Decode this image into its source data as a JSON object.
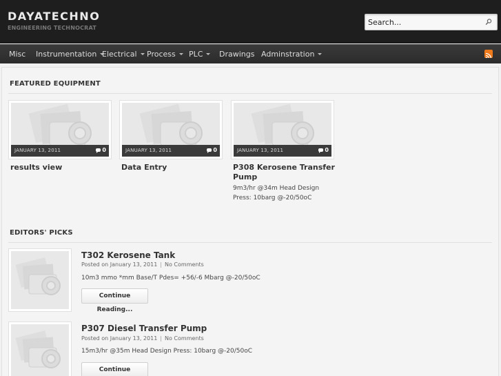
{
  "site": {
    "title": "DAYATECHNO",
    "tagline": "ENGINEERING TECHNOCRAT"
  },
  "search": {
    "placeholder": "Search..."
  },
  "nav": {
    "items": [
      {
        "label": "Misc",
        "dropdown": false
      },
      {
        "label": "Instrumentation",
        "dropdown": true
      },
      {
        "label": "Electrical",
        "dropdown": true
      },
      {
        "label": "Process",
        "dropdown": true
      },
      {
        "label": "PLC",
        "dropdown": true
      },
      {
        "label": "Drawings",
        "dropdown": false
      },
      {
        "label": "Adminstration",
        "dropdown": true
      }
    ]
  },
  "featured": {
    "heading": "FEATURED EQUIPMENT",
    "items": [
      {
        "date": "JANUARY 13, 2011",
        "comments": "0",
        "title": "results view",
        "excerpt": ""
      },
      {
        "date": "JANUARY 13, 2011",
        "comments": "0",
        "title": "Data Entry",
        "excerpt": ""
      },
      {
        "date": "JANUARY 13, 2011",
        "comments": "0",
        "title": "P308 Kerosene Transfer Pump",
        "excerpt": "9m3/hr @34m Head Design Press: 10barg @-20/50oC"
      }
    ]
  },
  "picks": {
    "heading": "EDITORS' PICKS",
    "items": [
      {
        "title": "T302 Kerosene Tank",
        "posted": "Posted on January 13, 2011",
        "comments": "No Comments",
        "excerpt": "10m3 mmo *mm Base/T Pdes= +56/-6 Mbarg @-20/50oC",
        "button": "Continue Reading..."
      },
      {
        "title": "P307 Diesel Transfer Pump",
        "posted": "Posted on January 13, 2011",
        "comments": "No Comments",
        "excerpt": "15m3/hr @35m Head Design Press: 10barg @-20/50oC",
        "button": "Continue Reading..."
      }
    ]
  },
  "colors": {
    "header_bg": "#1e1e1e",
    "nav_bg": "#2e2e2e",
    "rss": "#ef7a1b",
    "page_bg": "#f1f1f1"
  },
  "icons": {
    "search": "search-icon",
    "rss": "rss-icon",
    "comments": "comment-bubble-icon",
    "placeholder": "camera-placeholder-icon"
  }
}
